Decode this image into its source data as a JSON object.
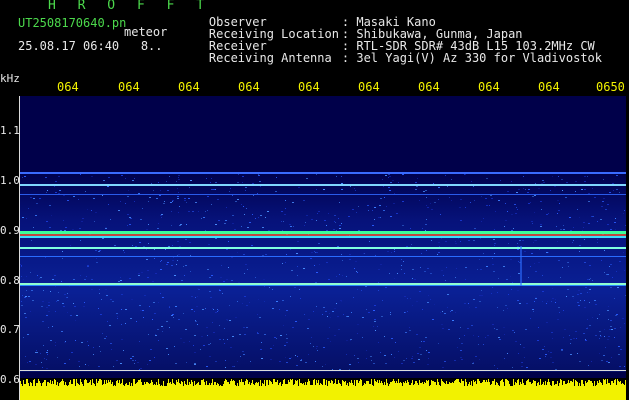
{
  "header": {
    "brand": "H R O F F T",
    "filename": "UT2508170640.pn",
    "meteor_label": "meteor",
    "datetime": "25.08.17 06:40   8..",
    "fields": [
      {
        "label": "Observer",
        "value": ": Masaki Kano"
      },
      {
        "label": "Receiving Location",
        "value": ": Shibukawa, Gunma, Japan"
      },
      {
        "label": "Receiver",
        "value": ": RTL-SDR SDR# 43dB L15 103.2MHz CW"
      },
      {
        "label": "Receiving Antenna",
        "value": ": 3el Yagi(V) Az 330 for Vladivostok"
      }
    ]
  },
  "axes": {
    "y_unit": "kHz",
    "y_ticks": [
      "1.1",
      "1.0",
      "0.9",
      "0.8",
      "0.7",
      "0.6"
    ],
    "x_ticks": [
      "064",
      "064",
      "064",
      "064",
      "064",
      "064",
      "064",
      "064",
      "064",
      "0650"
    ]
  },
  "colors": {
    "background": "#000000",
    "plot_background": "#00004a",
    "header_green": "#4cd94c",
    "tick_yellow": "#f2f200",
    "text_white": "#e8e8e8"
  }
}
